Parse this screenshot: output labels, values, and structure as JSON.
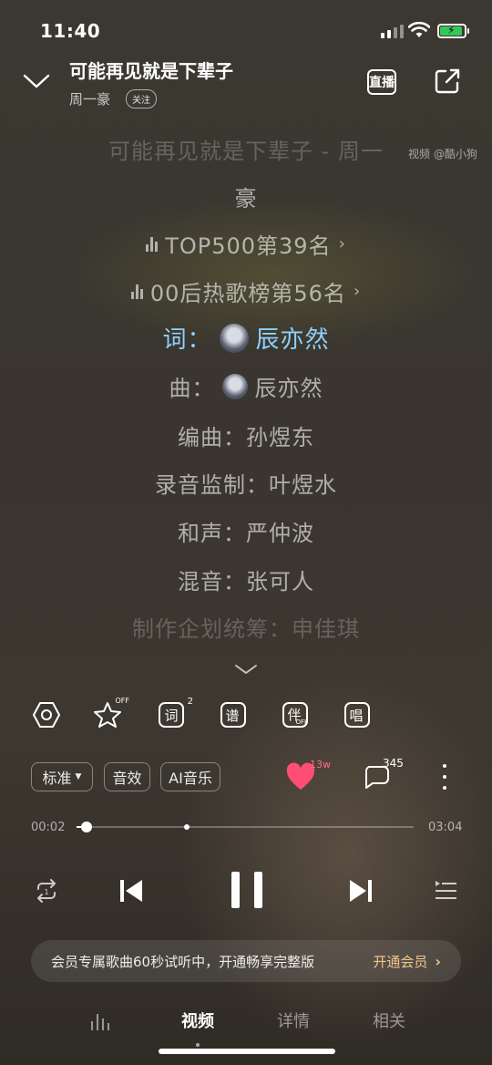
{
  "status_bar": {
    "time": "11:40"
  },
  "header": {
    "song_title": "可能再见就是下辈子",
    "artist": "周一豪",
    "follow_label": "关注",
    "live_label": "直播",
    "watermark": "视频 @酷小狗"
  },
  "lyrics": {
    "title_line": "可能再见就是下辈子 - 周一",
    "title_line_cont": "豪",
    "rank1": "TOP500第39名",
    "rank2": "00后热歌榜第56名",
    "lyricist": "词：",
    "lyricist_name": "辰亦然",
    "composer": "曲：",
    "composer_name": "辰亦然",
    "arranger": "编曲：孙煜东",
    "recording": "录音监制：叶煜水",
    "harmony": "和声：严仲波",
    "mixing": "混音：张可人",
    "producer": "制作企划统筹：申佳琪"
  },
  "tools": {
    "lyric_badge": "2",
    "star_badge": "OFF",
    "accompany_badge": "OFF"
  },
  "chips": {
    "quality": "标准",
    "effect": "音效",
    "ai_music": "AI音乐"
  },
  "social": {
    "likes": "13w",
    "comments": "345"
  },
  "progress": {
    "current": "00:02",
    "total": "03:04",
    "played_fraction": 0.03,
    "trial_marker_fraction": 0.326
  },
  "vip_banner": {
    "message": "会员专属歌曲60秒试听中，开通畅享完整版",
    "cta": "开通会员"
  },
  "tabs": {
    "video": "视频",
    "details": "详情",
    "related": "相关"
  },
  "colors": {
    "active_lyric": "#8fd0ff",
    "heart": "#ff4d73",
    "vip_cta": "#f2c68b",
    "battery": "#34c759"
  }
}
